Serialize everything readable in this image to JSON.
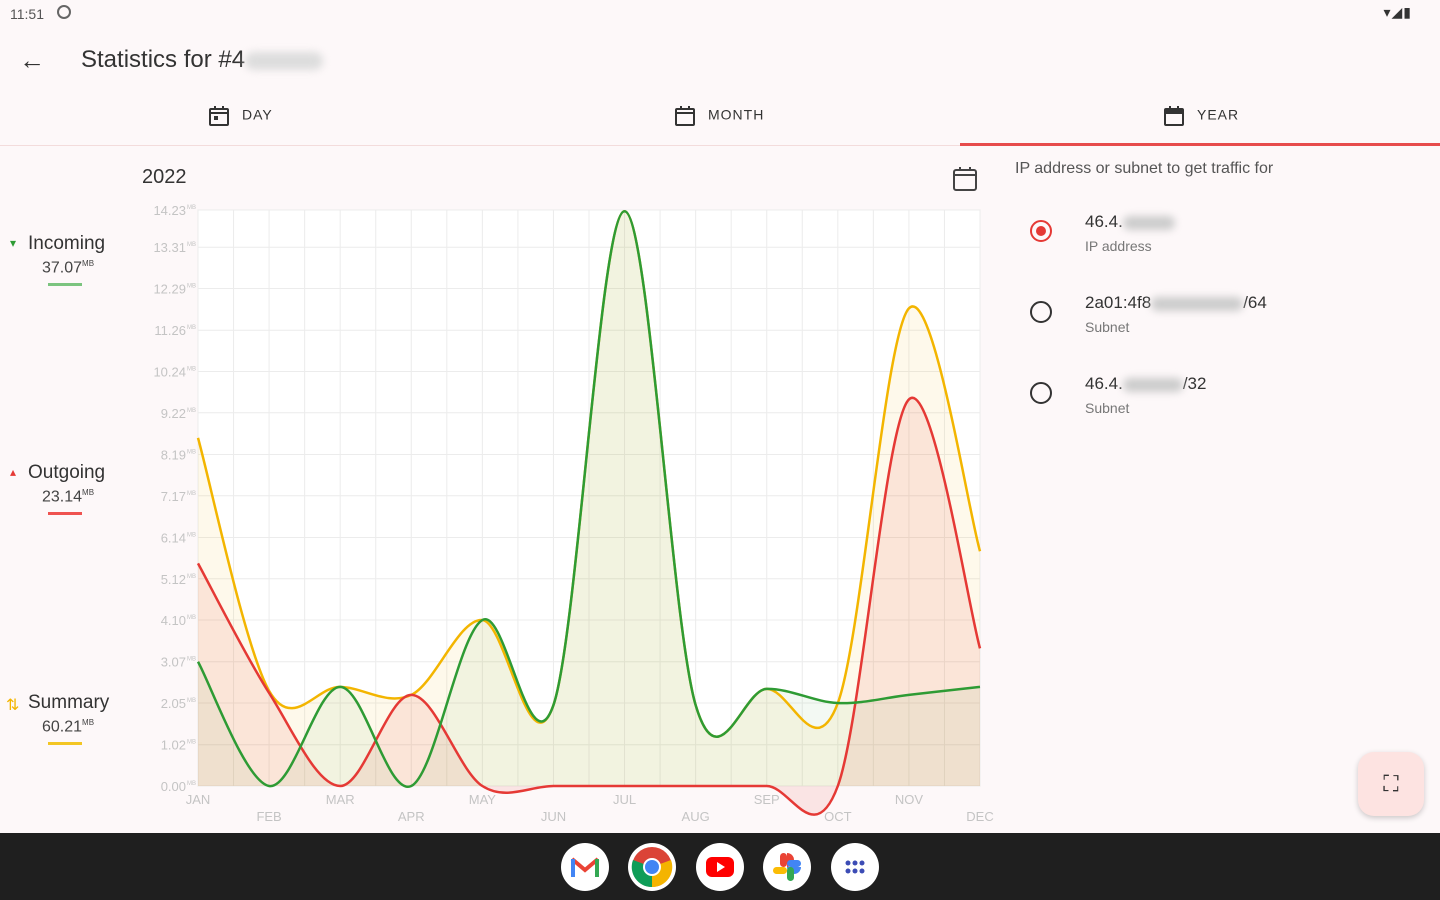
{
  "status_bar": {
    "time": "11:51",
    "right_icons": "▾◢▮"
  },
  "appbar": {
    "back_icon": "←",
    "title": "Statistics for #4"
  },
  "tabs": [
    {
      "label": "DAY",
      "icon": "calendar-day-icon"
    },
    {
      "label": "MONTH",
      "icon": "calendar-month-icon"
    },
    {
      "label": "YEAR",
      "icon": "calendar-year-icon",
      "active": true
    }
  ],
  "chart_header": {
    "year": "2022"
  },
  "legend": {
    "incoming": {
      "label": "Incoming",
      "value": "37.07",
      "unit": "MB"
    },
    "outgoing": {
      "label": "Outgoing",
      "value": "23.14",
      "unit": "MB"
    },
    "summary": {
      "label": "Summary",
      "value": "60.21",
      "unit": "MB"
    }
  },
  "colors": {
    "incoming": "#2e9b34",
    "outgoing": "#e53935",
    "summary": "#f3b500",
    "accent": "#e74c4c"
  },
  "chart_data": {
    "type": "area",
    "x": [
      "JAN",
      "FEB",
      "MAR",
      "APR",
      "MAY",
      "JUN",
      "JUL",
      "AUG",
      "SEP",
      "OCT",
      "NOV",
      "DEC"
    ],
    "y_ticks": [
      "0.00",
      "1.02",
      "2.05",
      "3.07",
      "4.10",
      "5.12",
      "6.14",
      "7.17",
      "8.19",
      "9.22",
      "10.24",
      "11.26",
      "12.29",
      "13.31",
      "14.23"
    ],
    "y_unit": "MB",
    "ylim": [
      0,
      14.23
    ],
    "grid": true,
    "series": [
      {
        "name": "Incoming",
        "color": "#2e9b34",
        "values": [
          3.07,
          0.0,
          2.45,
          0.0,
          4.1,
          2.0,
          14.2,
          2.0,
          2.4,
          2.05,
          2.25,
          2.45
        ]
      },
      {
        "name": "Outgoing",
        "color": "#e53935",
        "values": [
          5.5,
          2.3,
          0.0,
          2.25,
          0.0,
          0.0,
          0.0,
          0.0,
          0.0,
          0.0,
          9.55,
          3.4
        ]
      },
      {
        "name": "Summary",
        "color": "#f3b500",
        "values": [
          8.6,
          2.35,
          2.45,
          2.25,
          4.1,
          2.0,
          14.2,
          2.0,
          2.4,
          2.05,
          11.8,
          5.8
        ]
      }
    ]
  },
  "ip_panel": {
    "label": "IP address or subnet to get traffic for",
    "options": [
      {
        "main": "46.4.",
        "suffix": "",
        "sub": "IP address",
        "selected": true
      },
      {
        "main": "2a01:4f8",
        "suffix": "/64",
        "sub": "Subnet",
        "selected": false
      },
      {
        "main": "46.4.",
        "suffix": "/32",
        "sub": "Subnet",
        "selected": false
      }
    ]
  },
  "fab": {
    "icon": "fit-screen-icon",
    "glyph": "⛶"
  },
  "dock": [
    "gmail-app-icon",
    "chrome-app-icon",
    "youtube-app-icon",
    "photos-app-icon",
    "app-drawer-icon"
  ]
}
